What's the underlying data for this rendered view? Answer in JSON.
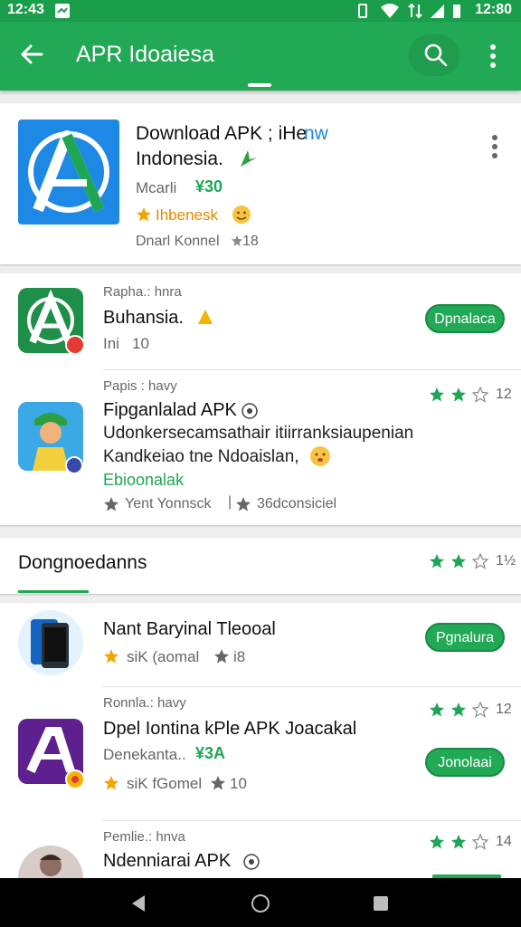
{
  "status_bar": {
    "time": "12:43",
    "right_text": "12:80"
  },
  "app_bar": {
    "title": "APR Idoaiesa"
  },
  "featured": {
    "title_line1": "Download APK ; iHe",
    "title_line1_accent": "nw",
    "title_line2": "Indonesia.",
    "price_label": "Mcarli",
    "price": "¥30",
    "rating_label": "Ihbenesk",
    "developer": "Dnarl Konnel",
    "count": "18"
  },
  "list1": [
    {
      "subtitle": "Rapha.: hnra",
      "title": "Buhansia.",
      "meta": "Ini",
      "meta_num": "10",
      "button": "Dpnalaca"
    },
    {
      "subtitle": "Papis : havy",
      "title": "Fipganlalad APK",
      "line2": "Udonkersecamsathair itiirranksiaupenian",
      "line3": "Kandkeiao tne Ndoaislan,",
      "accent": "Ebioonalak",
      "meta_left": "Yent Yonnsck",
      "meta_right": "36dconsiciel",
      "rating": "12"
    }
  ],
  "section": {
    "title": "Dongnoedanns",
    "rating": "1½"
  },
  "list2": [
    {
      "title": "Nant Baryinal Tleooal",
      "meta_left": "siK (aomal",
      "meta_right": "i8",
      "button": "Pgnalura"
    },
    {
      "subtitle": "Ronnla.: havy",
      "title": "Dpel Iontina kPle APK Joacakal",
      "line2": "Denekanta..",
      "price": "¥3A",
      "meta_left": "siK fGomel",
      "meta_right": "10",
      "rating": "12",
      "button": "Jonolaai"
    },
    {
      "subtitle": "Pemlie.: hnva",
      "title": "Ndenniarai APK",
      "rating": "14"
    }
  ],
  "colors": {
    "primary": "#21a955",
    "status_bar": "#1b9e4b",
    "star": "#1fa655"
  },
  "icons": {
    "back": "arrow-left",
    "search": "magnifier",
    "overflow": "three-dots"
  }
}
